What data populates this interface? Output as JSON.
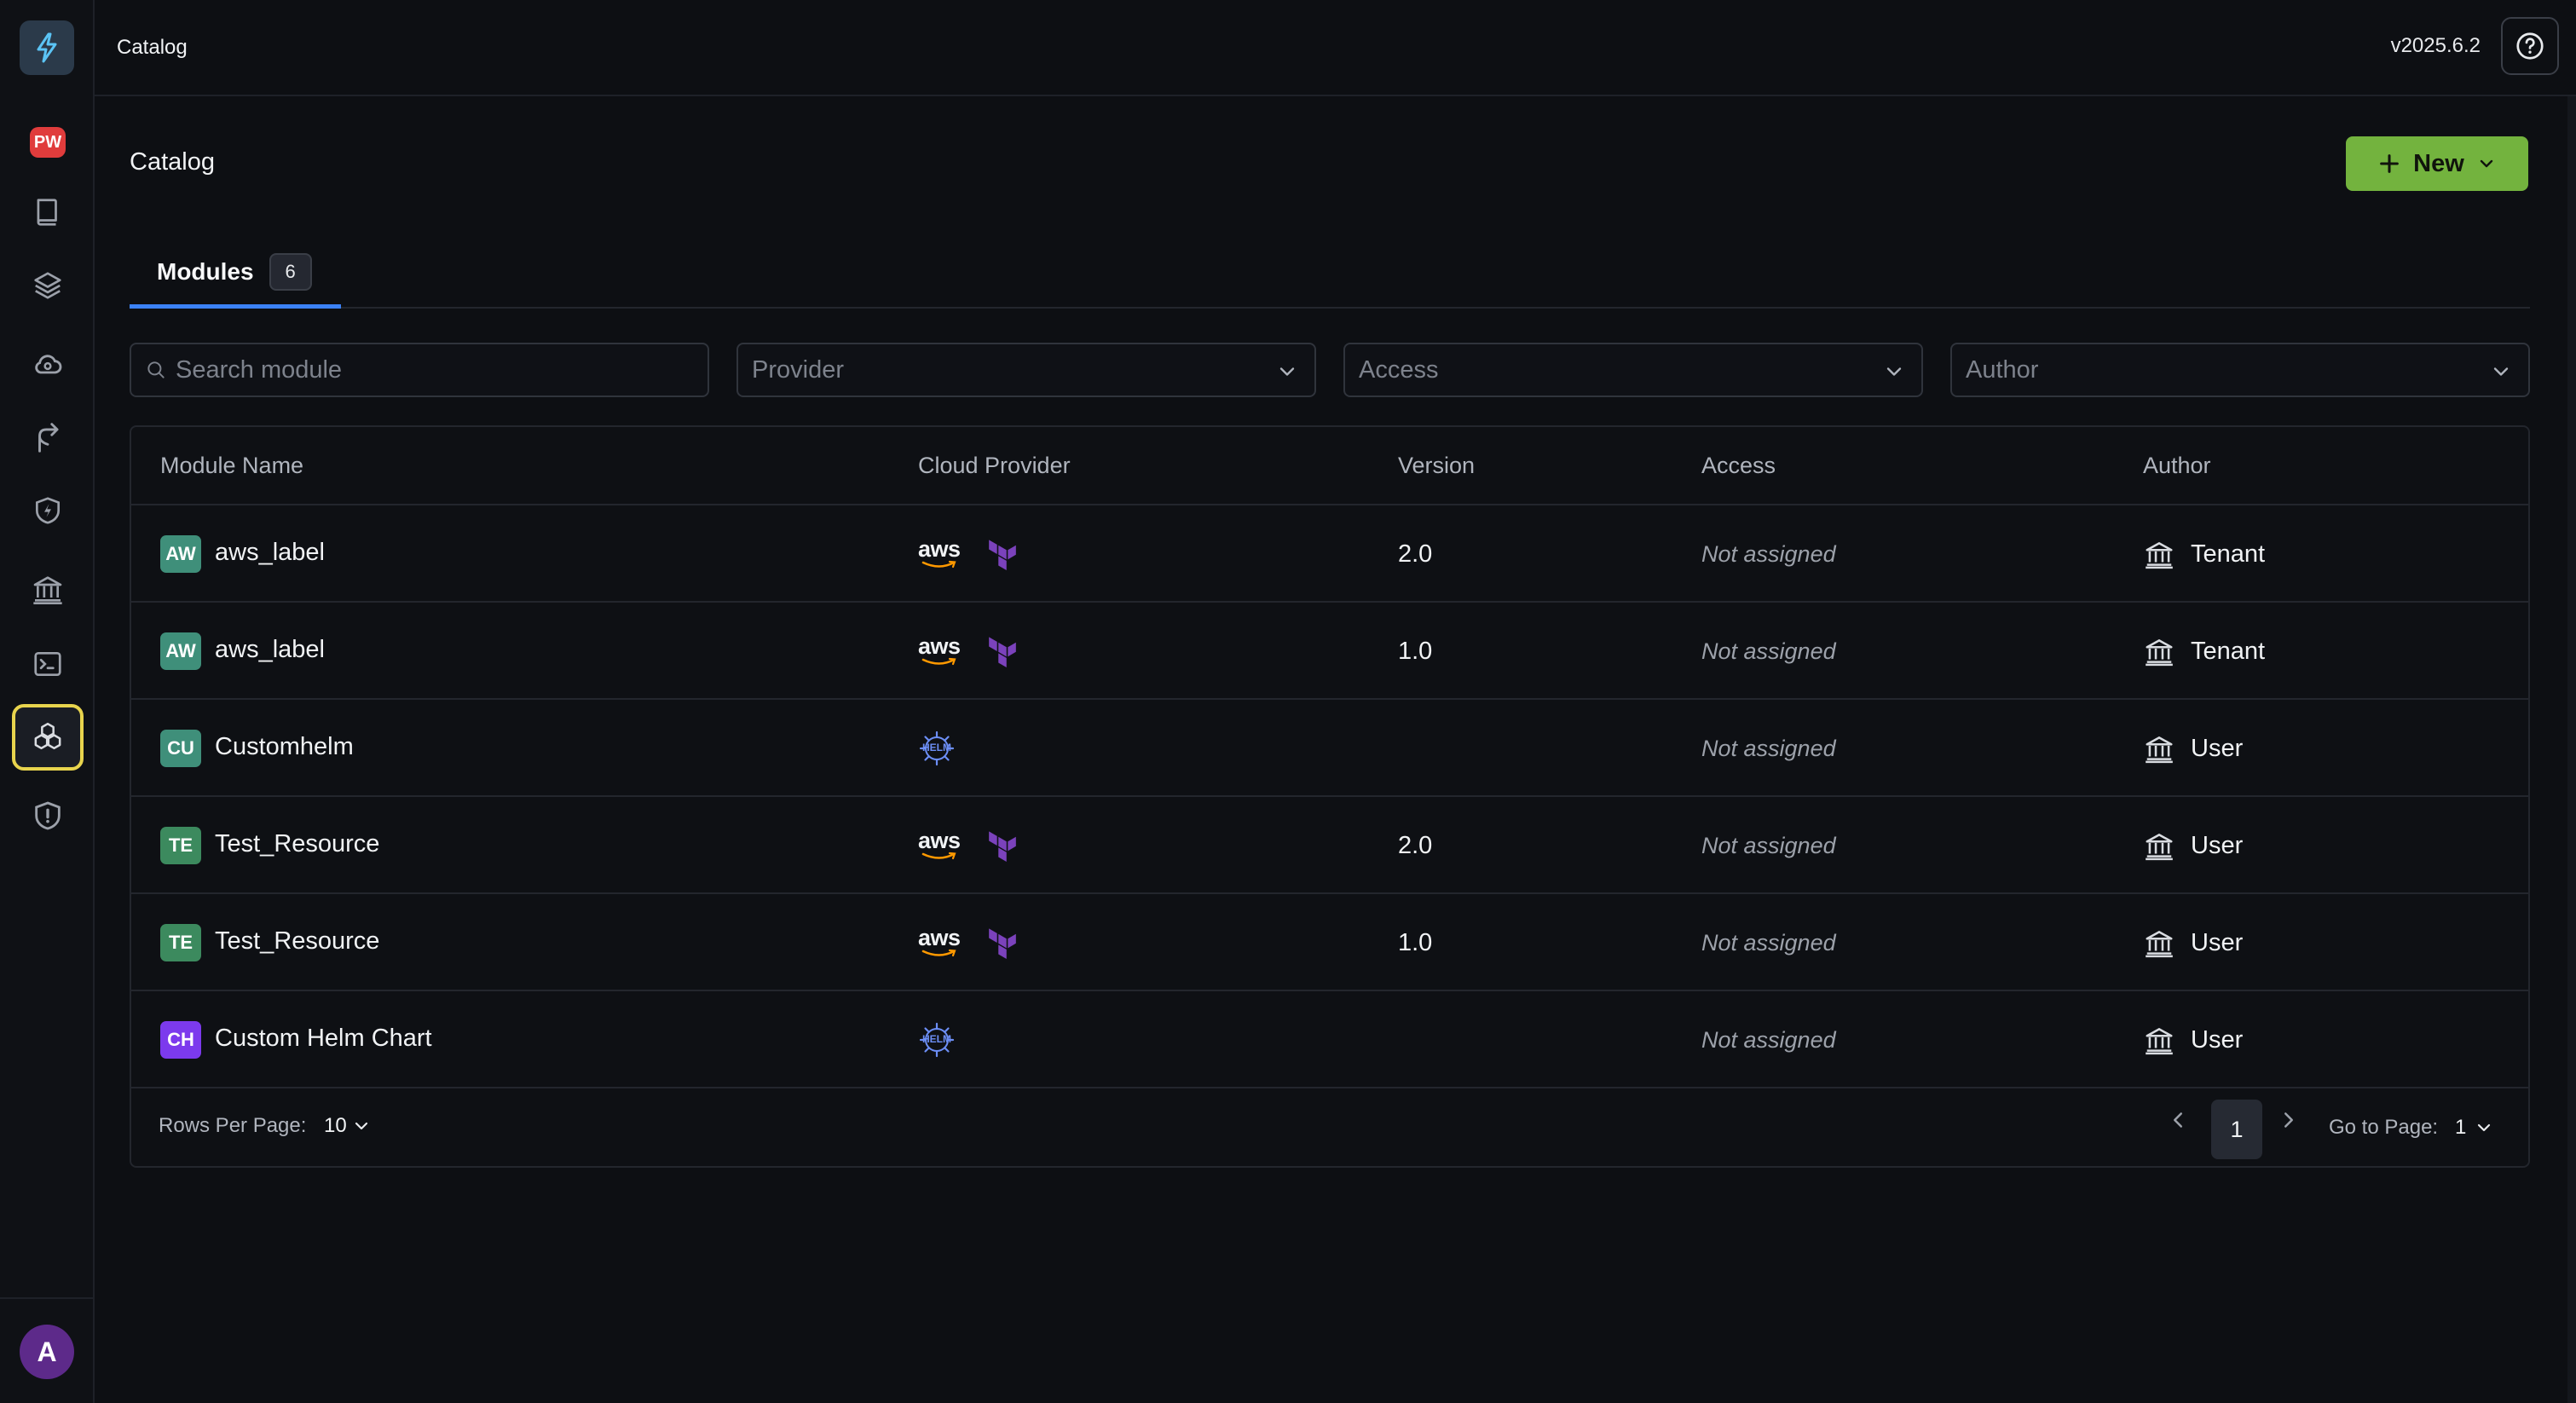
{
  "header": {
    "title": "Catalog",
    "version": "v2025.6.2"
  },
  "sidebar": {
    "workspace_badge": "PW",
    "avatar_initial": "A",
    "items": [
      {
        "icon": "book-icon"
      },
      {
        "icon": "layers-icon"
      },
      {
        "icon": "cloud-icon"
      },
      {
        "icon": "git-branch-icon"
      },
      {
        "icon": "shield-bolt-icon"
      },
      {
        "icon": "bank-icon"
      },
      {
        "icon": "terminal-icon"
      },
      {
        "icon": "modules-icon",
        "active": true
      },
      {
        "icon": "shield-alert-icon"
      }
    ]
  },
  "page": {
    "title": "Catalog",
    "new_button": "New"
  },
  "tabs": [
    {
      "label": "Modules",
      "count": "6"
    }
  ],
  "filters": {
    "search_placeholder": "Search module",
    "provider": "Provider",
    "access": "Access",
    "author": "Author"
  },
  "table": {
    "columns": [
      "Module Name",
      "Cloud Provider",
      "Version",
      "Access",
      "Author"
    ],
    "rows": [
      {
        "badge": "AW",
        "badge_color": "#3f8f7a",
        "name": "aws_label",
        "providers": [
          "aws",
          "terraform"
        ],
        "version": "2.0",
        "access": "Not assigned",
        "author": "Tenant"
      },
      {
        "badge": "AW",
        "badge_color": "#3f8f7a",
        "name": "aws_label",
        "providers": [
          "aws",
          "terraform"
        ],
        "version": "1.0",
        "access": "Not assigned",
        "author": "Tenant"
      },
      {
        "badge": "CU",
        "badge_color": "#3f8f7a",
        "name": "Customhelm",
        "providers": [
          "helm"
        ],
        "version": "",
        "access": "Not assigned",
        "author": "User"
      },
      {
        "badge": "TE",
        "badge_color": "#3c8a5e",
        "name": "Test_Resource",
        "providers": [
          "aws",
          "terraform"
        ],
        "version": "2.0",
        "access": "Not assigned",
        "author": "User"
      },
      {
        "badge": "TE",
        "badge_color": "#3c8a5e",
        "name": "Test_Resource",
        "providers": [
          "aws",
          "terraform"
        ],
        "version": "1.0",
        "access": "Not assigned",
        "author": "User"
      },
      {
        "badge": "CH",
        "badge_color": "#7c3aed",
        "name": "Custom Helm Chart",
        "providers": [
          "helm"
        ],
        "version": "",
        "access": "Not assigned",
        "author": "User"
      }
    ]
  },
  "pagination": {
    "rows_per_page_label": "Rows Per Page:",
    "rows_per_page": "10",
    "current_page": "1",
    "go_to_label": "Go to Page:",
    "go_to_value": "1"
  },
  "provider_labels": {
    "aws": "aws",
    "helm": "HELM"
  },
  "colors": {
    "accent_green": "#73b33e",
    "tab_underline": "#3b82f6",
    "active_nav_border": "#e8d44d",
    "terraform_purple": "#7b42bc",
    "aws_orange": "#ff9900"
  }
}
